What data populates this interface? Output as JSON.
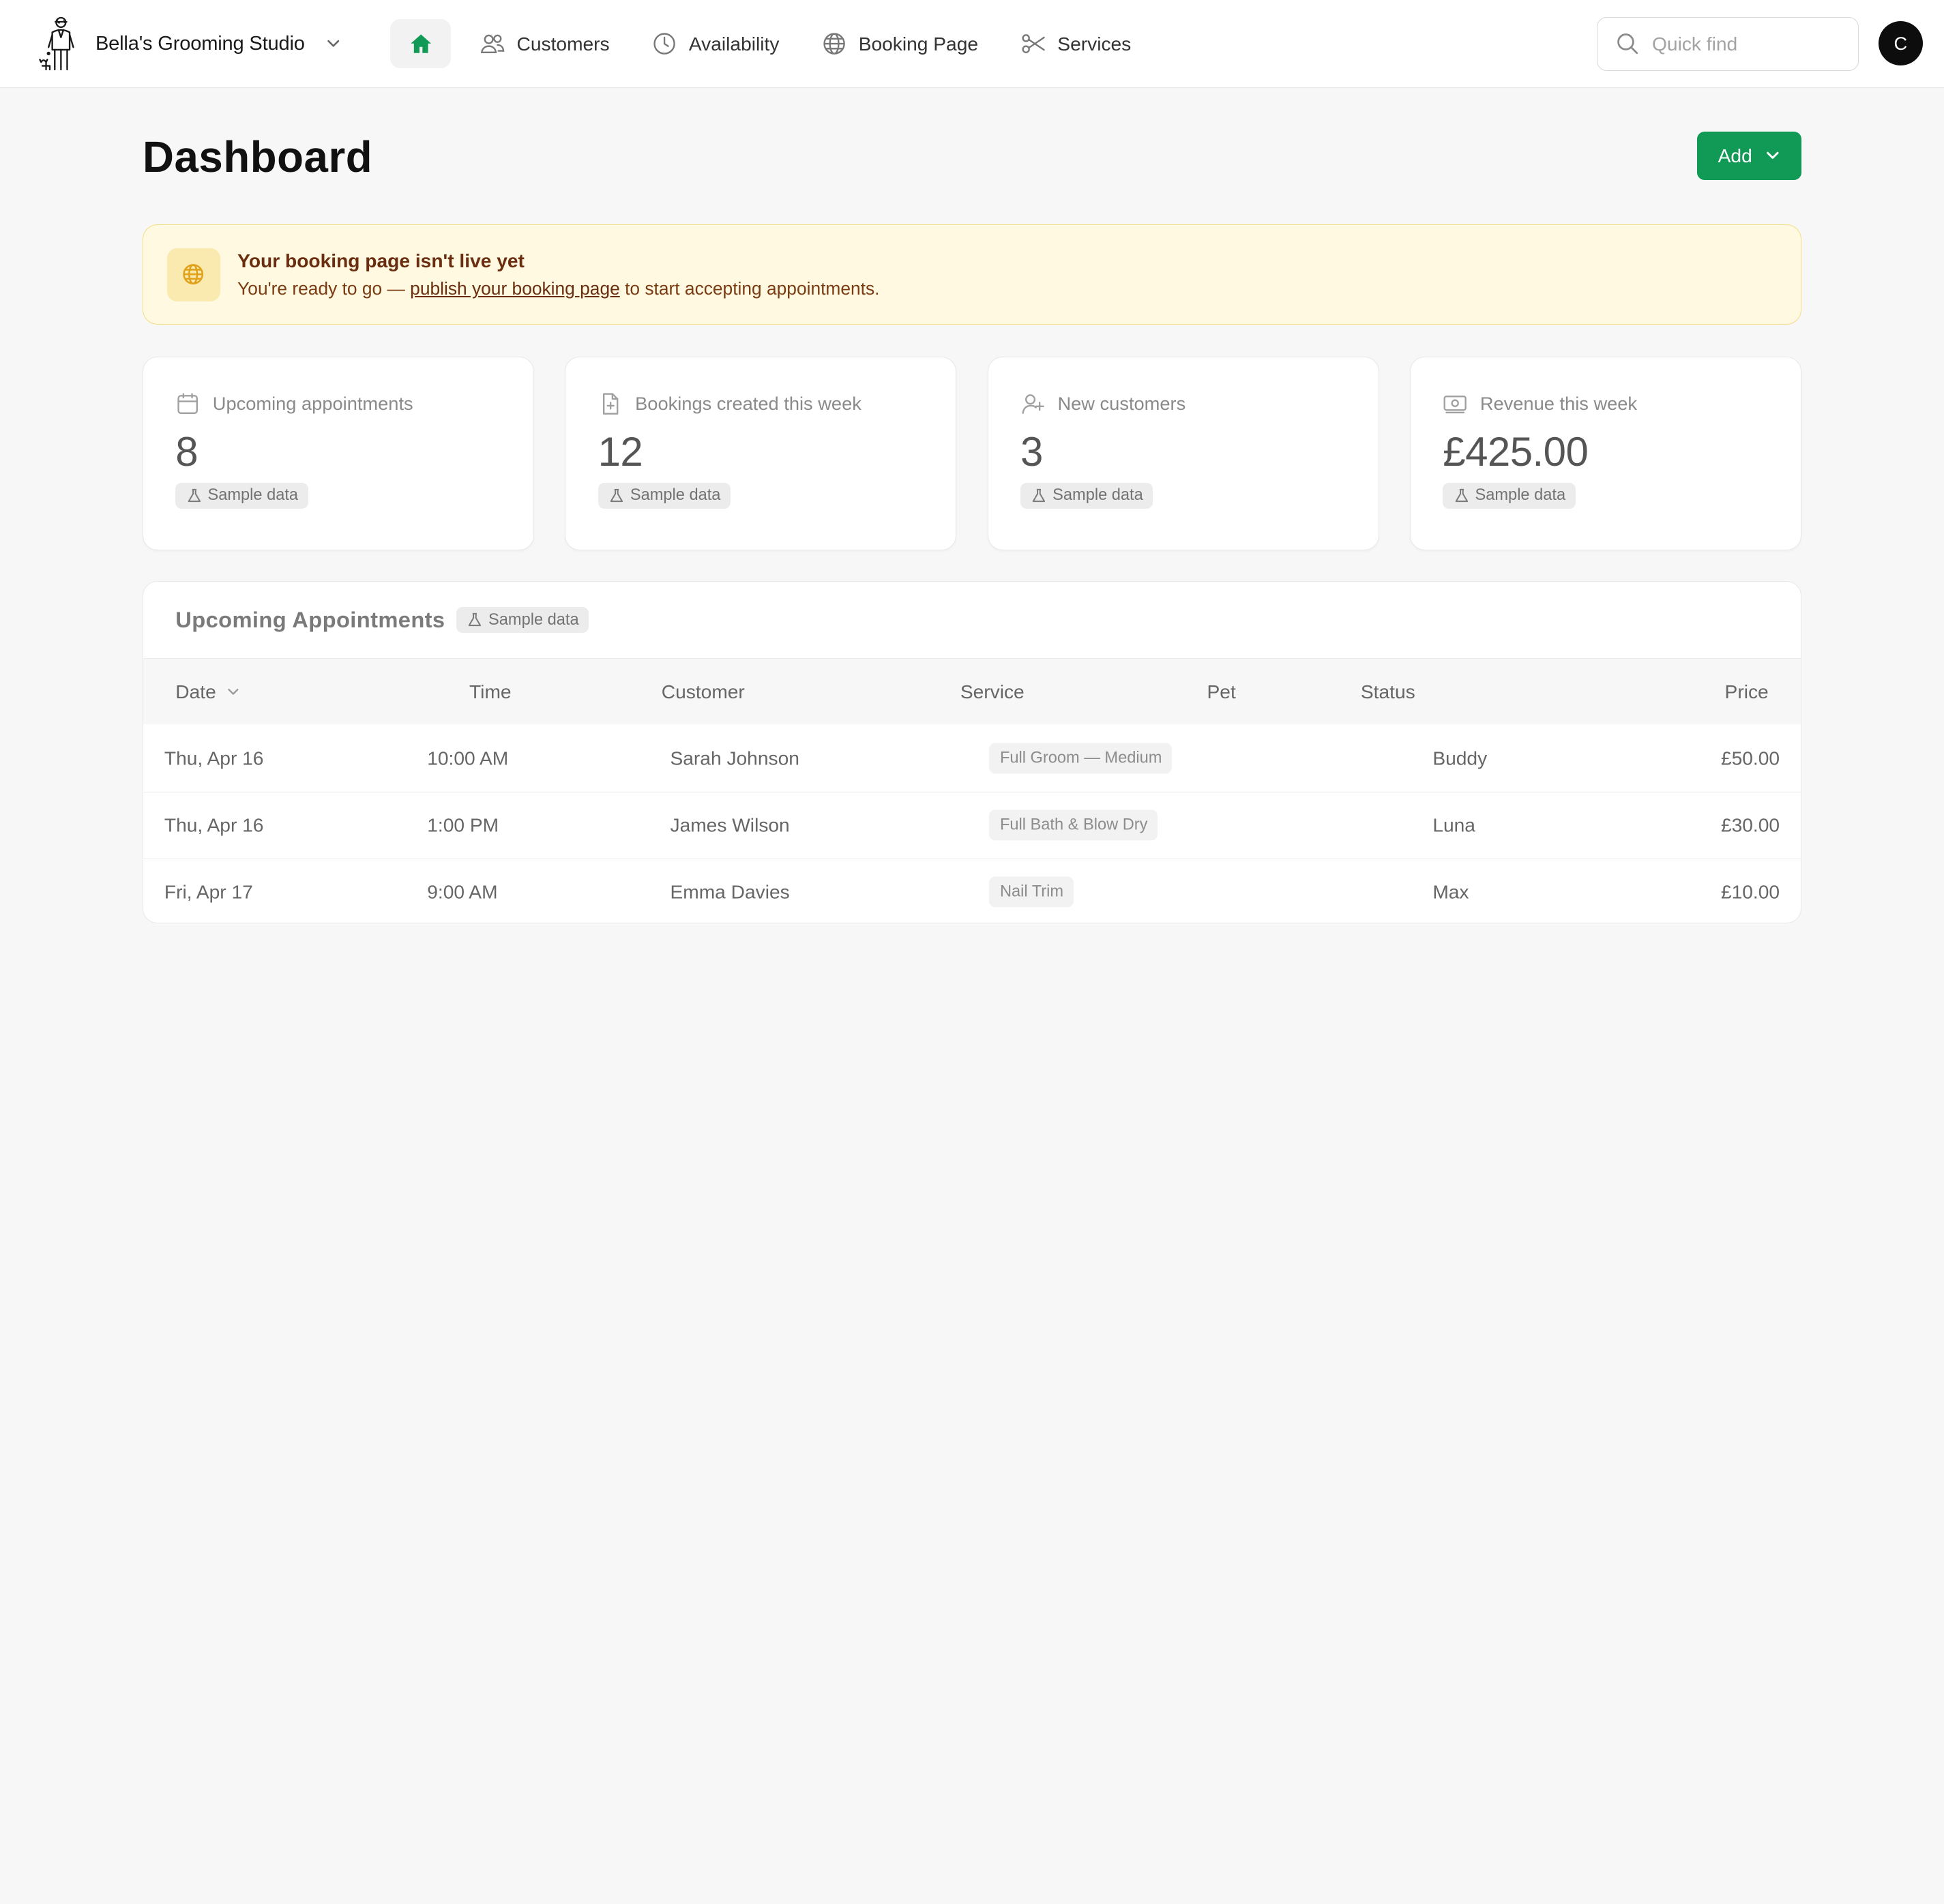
{
  "header": {
    "business_name": "Bella's Grooming Studio",
    "nav": {
      "customers": "Customers",
      "availability": "Availability",
      "booking_page": "Booking Page",
      "services": "Services"
    },
    "search_placeholder": "Quick find",
    "avatar_initial": "C"
  },
  "page": {
    "title": "Dashboard",
    "add_label": "Add"
  },
  "banner": {
    "title": "Your booking page isn't live yet",
    "prefix": "You're ready to go — ",
    "link": "publish your booking page",
    "suffix": " to start accepting appointments."
  },
  "sample_label": "Sample data",
  "stats": [
    {
      "label": "Upcoming appointments",
      "value": "8",
      "icon": "calendar-icon"
    },
    {
      "label": "Bookings created this week",
      "value": "12",
      "icon": "document-plus-icon"
    },
    {
      "label": "New customers",
      "value": "3",
      "icon": "user-plus-icon"
    },
    {
      "label": "Revenue this week",
      "value": "£425.00",
      "icon": "banknote-icon"
    }
  ],
  "appointments": {
    "title": "Upcoming Appointments",
    "columns": {
      "date": "Date",
      "time": "Time",
      "customer": "Customer",
      "service": "Service",
      "pet": "Pet",
      "status": "Status",
      "price": "Price"
    },
    "rows": [
      {
        "date": "Thu, Apr 16",
        "time": "10:00 AM",
        "customer": "Sarah Johnson",
        "service": "Full Groom — Medium",
        "pet": "Buddy",
        "price": "£50.00"
      },
      {
        "date": "Thu, Apr 16",
        "time": "1:00 PM",
        "customer": "James Wilson",
        "service": "Full Bath & Blow Dry",
        "pet": "Luna",
        "price": "£30.00"
      },
      {
        "date": "Fri, Apr 17",
        "time": "9:00 AM",
        "customer": "Emma Davies",
        "service": "Nail Trim",
        "pet": "Max",
        "price": "£10.00"
      }
    ]
  },
  "colors": {
    "accent_green": "#119a55",
    "banner_bg": "#fef9e0",
    "banner_border": "#f5dd84",
    "banner_text": "#6b2d0f"
  }
}
